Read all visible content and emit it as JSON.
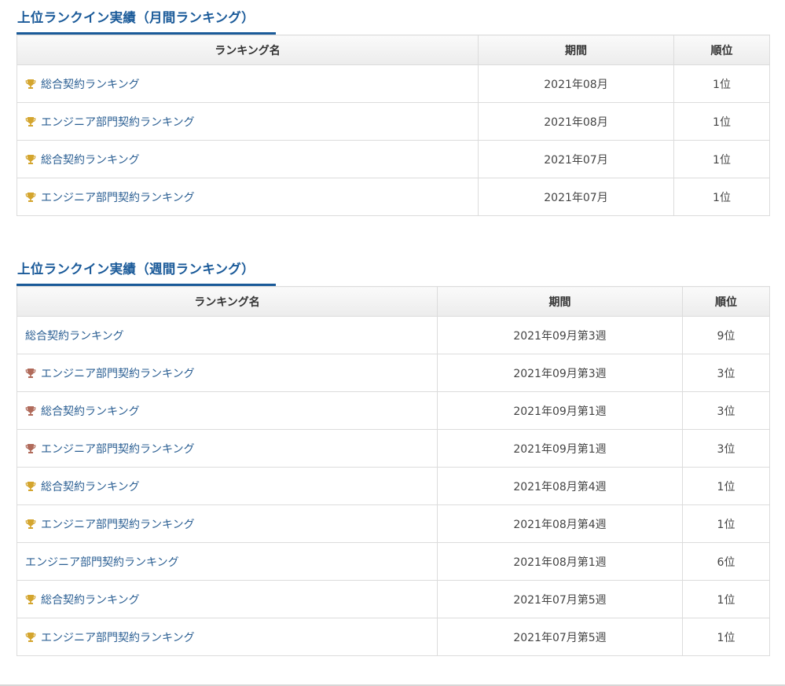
{
  "colors": {
    "heading": "#1a5a99",
    "link": "#2b5f93",
    "gold": "#d4a52e",
    "bronze": "#b06a5a"
  },
  "monthly": {
    "title": "上位ランクイン実績（月間ランキング）",
    "headers": {
      "name": "ランキング名",
      "period": "期間",
      "rank": "順位"
    },
    "rows": [
      {
        "trophy": "gold",
        "name": "総合契約ランキング",
        "period": "2021年08月",
        "rank": "1位"
      },
      {
        "trophy": "gold",
        "name": "エンジニア部門契約ランキング",
        "period": "2021年08月",
        "rank": "1位"
      },
      {
        "trophy": "gold",
        "name": "総合契約ランキング",
        "period": "2021年07月",
        "rank": "1位"
      },
      {
        "trophy": "gold",
        "name": "エンジニア部門契約ランキング",
        "period": "2021年07月",
        "rank": "1位"
      }
    ]
  },
  "weekly": {
    "title": "上位ランクイン実績（週間ランキング）",
    "headers": {
      "name": "ランキング名",
      "period": "期間",
      "rank": "順位"
    },
    "rows": [
      {
        "trophy": "none",
        "name": "総合契約ランキング",
        "period": "2021年09月第3週",
        "rank": "9位"
      },
      {
        "trophy": "bronze",
        "name": "エンジニア部門契約ランキング",
        "period": "2021年09月第3週",
        "rank": "3位"
      },
      {
        "trophy": "bronze",
        "name": "総合契約ランキング",
        "period": "2021年09月第1週",
        "rank": "3位"
      },
      {
        "trophy": "bronze",
        "name": "エンジニア部門契約ランキング",
        "period": "2021年09月第1週",
        "rank": "3位"
      },
      {
        "trophy": "gold",
        "name": "総合契約ランキング",
        "period": "2021年08月第4週",
        "rank": "1位"
      },
      {
        "trophy": "gold",
        "name": "エンジニア部門契約ランキング",
        "period": "2021年08月第4週",
        "rank": "1位"
      },
      {
        "trophy": "none",
        "name": "エンジニア部門契約ランキング",
        "period": "2021年08月第1週",
        "rank": "6位"
      },
      {
        "trophy": "gold",
        "name": "総合契約ランキング",
        "period": "2021年07月第5週",
        "rank": "1位"
      },
      {
        "trophy": "gold",
        "name": "エンジニア部門契約ランキング",
        "period": "2021年07月第5週",
        "rank": "1位"
      }
    ]
  }
}
